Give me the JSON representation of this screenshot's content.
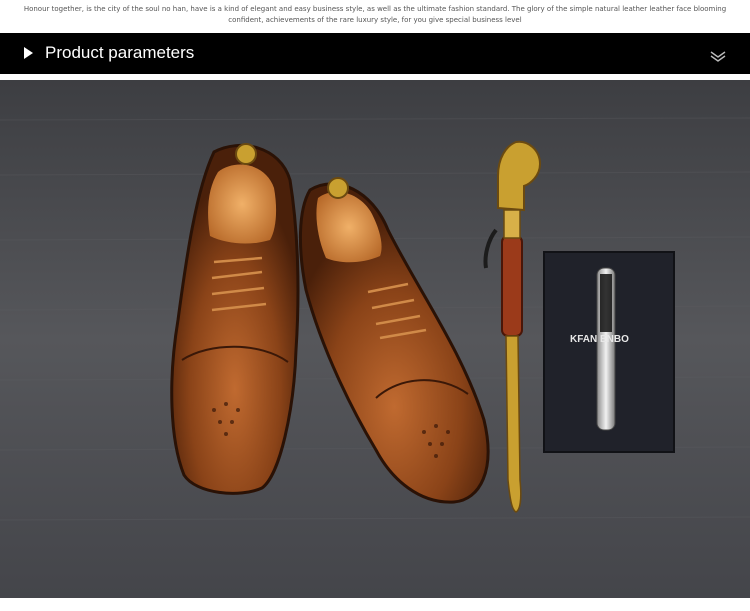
{
  "intro": {
    "text": "Honour together, is the city of the soul no han, have is a kind of elegant and easy business style, as well as the ultimate fashion standard. The glory of the simple natural leather leather face blooming confident, achievements of the rare luxury style, for you give special business level"
  },
  "section": {
    "title": "Product parameters",
    "play_icon": "play-triangle-icon",
    "expand_icon": "double-chevron-down-icon"
  },
  "photo": {
    "box_label": "KFAN ENBO",
    "colors": {
      "leather": "#8a4318",
      "leather_highlight": "#c06a30",
      "insole": "#e09a52",
      "gold": "#c9a030",
      "backdrop": "#4c4d51",
      "box": "#20222a"
    }
  }
}
